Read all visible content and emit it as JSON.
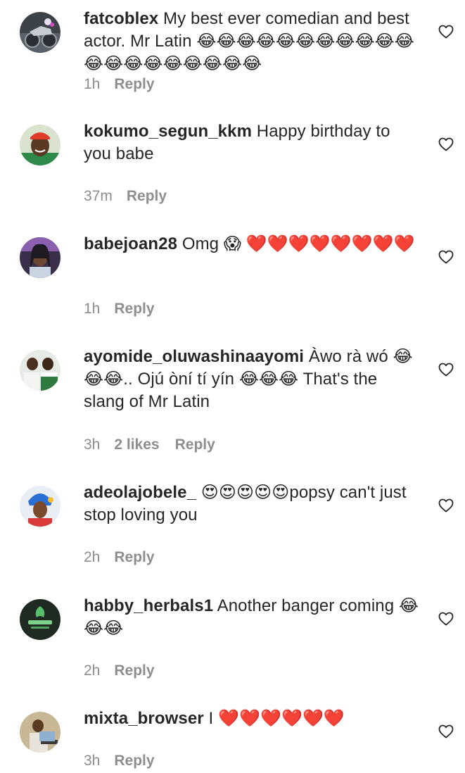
{
  "colors": {
    "text": "#262626",
    "muted": "#8e8e8e",
    "background": "#ffffff"
  },
  "comments": [
    {
      "username": "fatcoblex",
      "text": " My best ever comedian and best actor. Mr Latin 😂😂😂😂😂😂😂😂😂😂😂😂😂😂😂😂😂😂😂😂",
      "time": "1h",
      "likes": "",
      "reply": "Reply",
      "avatar": "motorcycle photo"
    },
    {
      "username": "kokumo_segun_kkm",
      "text": " Happy birthday to you babe",
      "time": "37m",
      "likes": "",
      "reply": "Reply",
      "avatar": "smiling man in red cap"
    },
    {
      "username": "babejoan28",
      "text": " Omg 😱 ❤️❤️❤️❤️❤️❤️❤️❤️",
      "time": "1h",
      "likes": "",
      "reply": "Reply",
      "avatar": "woman with braids"
    },
    {
      "username": "ayomide_oluwashinaayomi",
      "text": " Àwo rà wó 😂😂😂.. Ojú òní tí yín 😂😂😂 That's the slang of Mr Latin",
      "time": "3h",
      "likes": "2 likes",
      "reply": "Reply",
      "avatar": "two young men"
    },
    {
      "username": "adeolajobele_",
      "text": " 😍😍😍😍😍popsy can't just stop loving you",
      "time": "2h",
      "likes": "",
      "reply": "Reply",
      "avatar": "woman in blue gele"
    },
    {
      "username": "habby_herbals1",
      "text": " Another banger coming 😂😂😂",
      "time": "2h",
      "likes": "",
      "reply": "Reply",
      "avatar": "herbals logo"
    },
    {
      "username": "mixta_browser",
      "text": " I ❤️❤️❤️❤️❤️❤️",
      "time": "3h",
      "likes": "",
      "reply": "Reply",
      "avatar": "man at laptop"
    }
  ]
}
